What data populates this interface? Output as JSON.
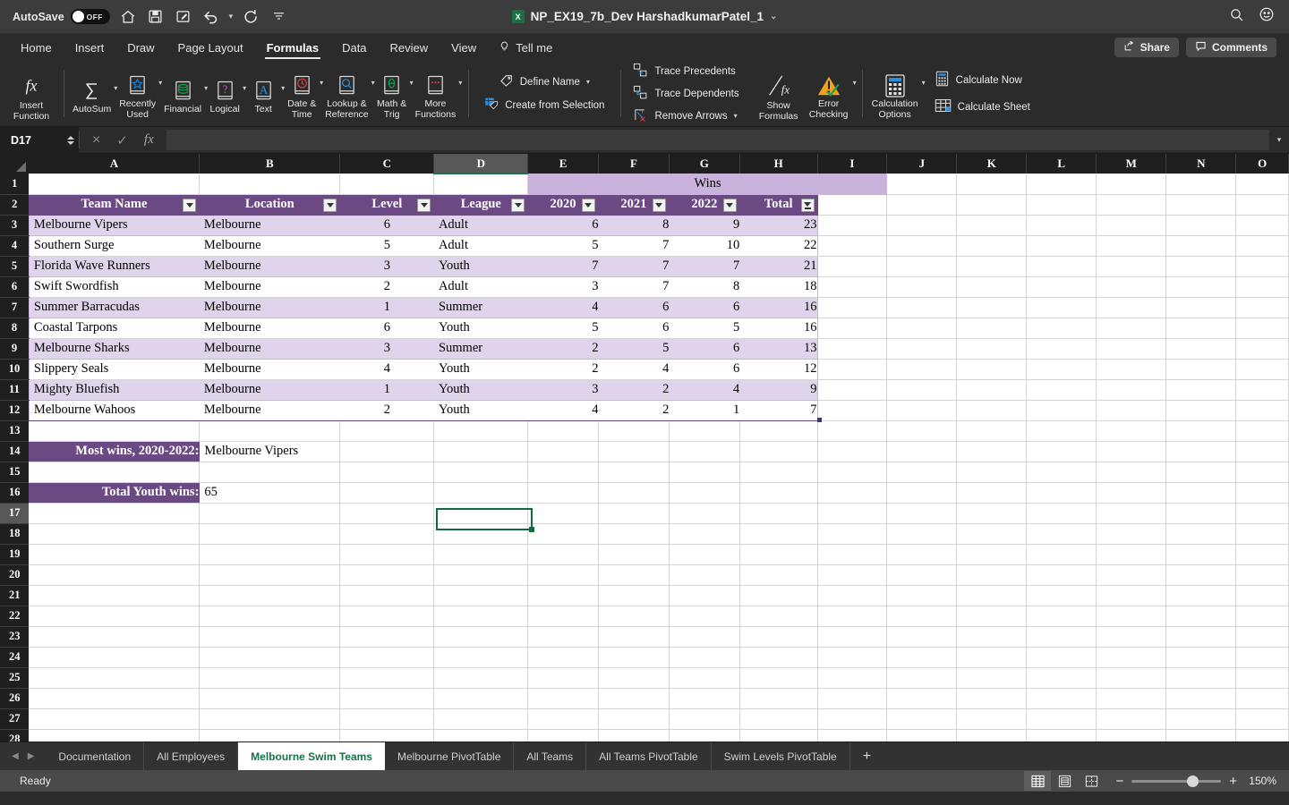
{
  "titlebar": {
    "autosave_label": "AutoSave",
    "autosave_state": "OFF",
    "document_title": "NP_EX19_7b_Dev HarshadkumarPatel_1",
    "qat_items": [
      {
        "name": "home-icon",
        "label": "Home"
      },
      {
        "name": "save-icon",
        "label": "Save"
      },
      {
        "name": "edit-icon",
        "label": "Quick Edit"
      },
      {
        "name": "undo-icon",
        "label": "Undo"
      },
      {
        "name": "redo-icon",
        "label": "Redo"
      },
      {
        "name": "customize-qat-icon",
        "label": "Customize Quick Access Toolbar"
      }
    ],
    "right_items": [
      {
        "name": "search-icon",
        "label": "Search"
      },
      {
        "name": "account-icon",
        "label": "Account"
      }
    ]
  },
  "ribbon": {
    "tabs": [
      {
        "label": "Home",
        "active": false
      },
      {
        "label": "Insert",
        "active": false
      },
      {
        "label": "Draw",
        "active": false
      },
      {
        "label": "Page Layout",
        "active": false
      },
      {
        "label": "Formulas",
        "active": true
      },
      {
        "label": "Data",
        "active": false
      },
      {
        "label": "Review",
        "active": false
      },
      {
        "label": "View",
        "active": false
      }
    ],
    "tell_me": "Tell me",
    "share_label": "Share",
    "comments_label": "Comments",
    "insert_function": {
      "line1": "Insert",
      "line2": "Function"
    },
    "function_library": [
      {
        "label1": "AutoSum",
        "label2": ""
      },
      {
        "label1": "Recently",
        "label2": "Used"
      },
      {
        "label1": "Financial",
        "label2": ""
      },
      {
        "label1": "Logical",
        "label2": ""
      },
      {
        "label1": "Text",
        "label2": ""
      },
      {
        "label1": "Date &",
        "label2": "Time"
      },
      {
        "label1": "Lookup &",
        "label2": "Reference"
      },
      {
        "label1": "Math &",
        "label2": "Trig"
      },
      {
        "label1": "More",
        "label2": "Functions"
      }
    ],
    "defined_names": {
      "define_name": "Define Name",
      "create_from_selection": "Create from Selection"
    },
    "formula_auditing": {
      "trace_precedents": "Trace Precedents",
      "trace_dependents": "Trace Dependents",
      "remove_arrows": "Remove Arrows",
      "show_formulas_1": "Show",
      "show_formulas_2": "Formulas",
      "error_checking_1": "Error",
      "error_checking_2": "Checking"
    },
    "calculation": {
      "options_1": "Calculation",
      "options_2": "Options",
      "calculate_now": "Calculate Now",
      "calculate_sheet": "Calculate Sheet"
    }
  },
  "formula_bar": {
    "name_box": "D17",
    "formula_value": "",
    "cancel_icon": "×",
    "enter_icon": "✓",
    "fx_icon": "fx"
  },
  "grid": {
    "columns": [
      "A",
      "B",
      "C",
      "D",
      "E",
      "F",
      "G",
      "H",
      "I",
      "J",
      "K",
      "L",
      "M",
      "N",
      "O"
    ],
    "selected_column": "D",
    "selected_row": 17,
    "rows": [
      1,
      2,
      3,
      4,
      5,
      6,
      7,
      8,
      9,
      10,
      11,
      12,
      13,
      14,
      15,
      16,
      17,
      18,
      19,
      20,
      21,
      22,
      23,
      24,
      25,
      26,
      27,
      28
    ],
    "merged_header": "Wins",
    "table_headers": [
      "Team Name",
      "Location",
      "Level",
      "League",
      "2020",
      "2021",
      "2022",
      "Total"
    ],
    "table_rows": [
      {
        "team": "Melbourne Vipers",
        "location": "Melbourne",
        "level": "6",
        "league": "Adult",
        "y2020": "6",
        "y2021": "8",
        "y2022": "9",
        "total": "23"
      },
      {
        "team": "Southern Surge",
        "location": "Melbourne",
        "level": "5",
        "league": "Adult",
        "y2020": "5",
        "y2021": "7",
        "y2022": "10",
        "total": "22"
      },
      {
        "team": "Florida Wave Runners",
        "location": "Melbourne",
        "level": "3",
        "league": "Youth",
        "y2020": "7",
        "y2021": "7",
        "y2022": "7",
        "total": "21"
      },
      {
        "team": "Swift Swordfish",
        "location": "Melbourne",
        "level": "2",
        "league": "Adult",
        "y2020": "3",
        "y2021": "7",
        "y2022": "8",
        "total": "18"
      },
      {
        "team": "Summer Barracudas",
        "location": "Melbourne",
        "level": "1",
        "league": "Summer",
        "y2020": "4",
        "y2021": "6",
        "y2022": "6",
        "total": "16"
      },
      {
        "team": "Coastal Tarpons",
        "location": "Melbourne",
        "level": "6",
        "league": "Youth",
        "y2020": "5",
        "y2021": "6",
        "y2022": "5",
        "total": "16"
      },
      {
        "team": "Melbourne Sharks",
        "location": "Melbourne",
        "level": "3",
        "league": "Summer",
        "y2020": "2",
        "y2021": "5",
        "y2022": "6",
        "total": "13"
      },
      {
        "team": "Slippery Seals",
        "location": "Melbourne",
        "level": "4",
        "league": "Youth",
        "y2020": "2",
        "y2021": "4",
        "y2022": "6",
        "total": "12"
      },
      {
        "team": "Mighty Bluefish",
        "location": "Melbourne",
        "level": "1",
        "league": "Youth",
        "y2020": "3",
        "y2021": "2",
        "y2022": "4",
        "total": "9"
      },
      {
        "team": "Melbourne Wahoos",
        "location": "Melbourne",
        "level": "2",
        "league": "Youth",
        "y2020": "4",
        "y2021": "2",
        "y2022": "1",
        "total": "7"
      }
    ],
    "summary": [
      {
        "row": 14,
        "label": "Most wins, 2020-2022:",
        "value": "Melbourne Vipers"
      },
      {
        "row": 16,
        "label": "Total Youth wins:",
        "value": "65"
      }
    ],
    "colors": {
      "table_header_purple": "#6b4a84",
      "band_light_purple": "#e0d3ec",
      "merged_purple": "#c9b3dd",
      "selection_green": "#0f6b3c"
    }
  },
  "sheet_tabs": {
    "tabs": [
      {
        "label": "Documentation",
        "active": false
      },
      {
        "label": "All Employees",
        "active": false
      },
      {
        "label": "Melbourne Swim Teams",
        "active": true
      },
      {
        "label": "Melbourne PivotTable",
        "active": false
      },
      {
        "label": "All Teams",
        "active": false
      },
      {
        "label": "All Teams PivotTable",
        "active": false
      },
      {
        "label": "Swim Levels PivotTable",
        "active": false
      }
    ],
    "add_label": "+"
  },
  "status_bar": {
    "status": "Ready",
    "views": [
      {
        "name": "normal-view-icon",
        "active": true
      },
      {
        "name": "page-layout-view-icon",
        "active": false
      },
      {
        "name": "page-break-view-icon",
        "active": false
      }
    ],
    "zoom_out": "−",
    "zoom_in": "+",
    "zoom_level": "150%"
  }
}
